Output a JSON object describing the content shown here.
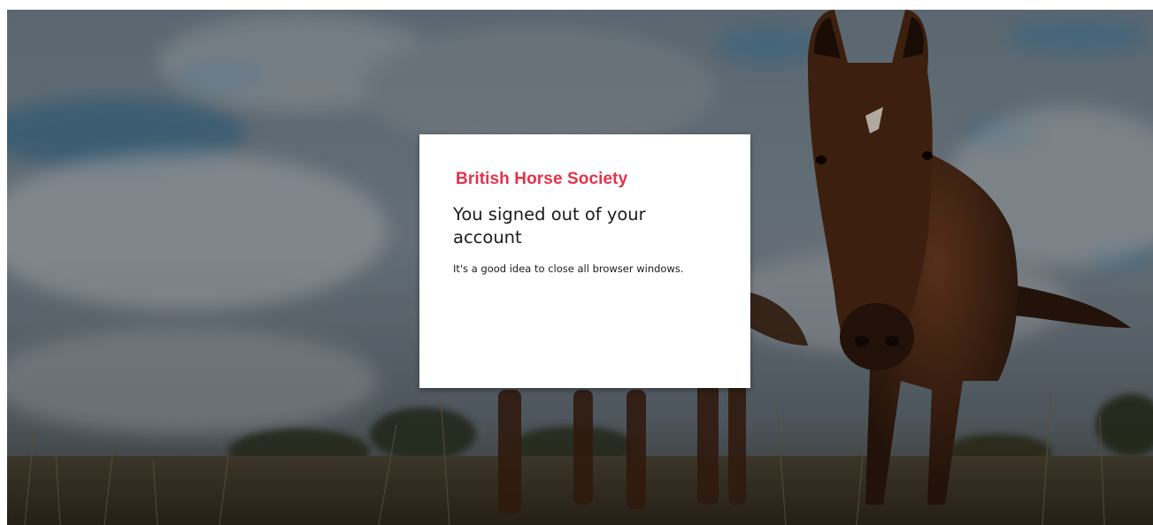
{
  "brand": {
    "name": "British Horse Society",
    "color": "#e2324a"
  },
  "signout": {
    "title": "You signed out of your account",
    "message": "It's a good idea to close all browser windows."
  }
}
